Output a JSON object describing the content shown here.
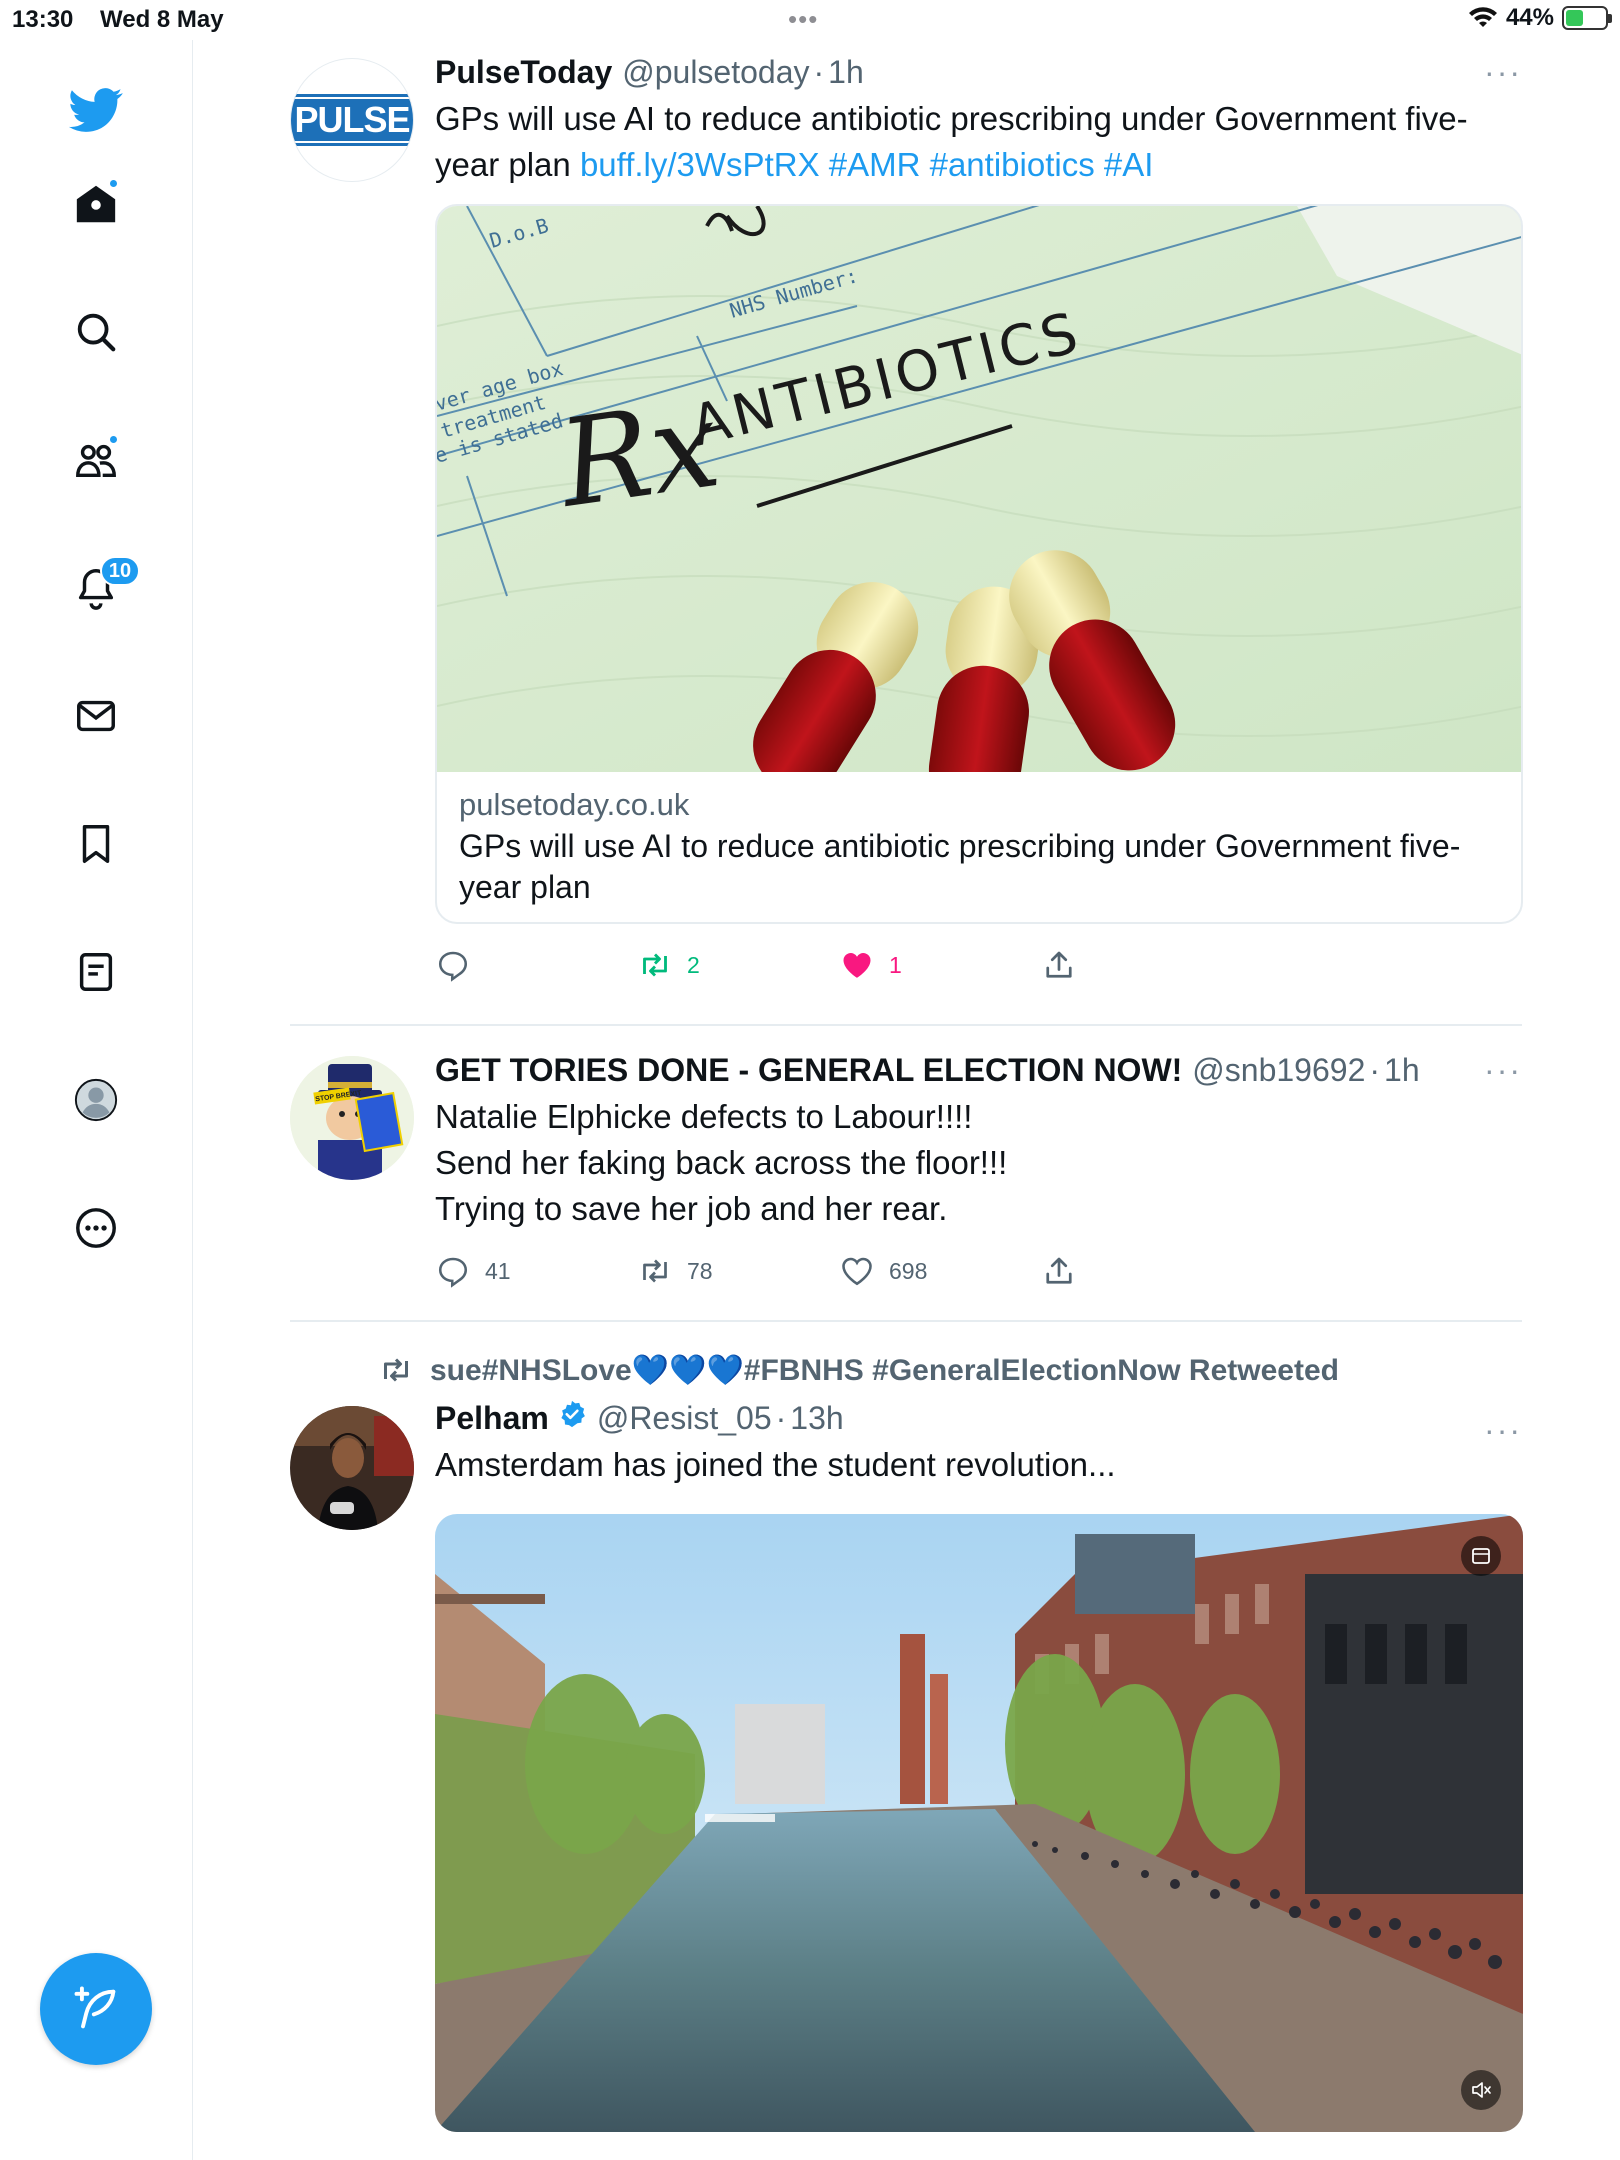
{
  "status_bar": {
    "time": "13:30",
    "date": "Wed 8 May",
    "battery": "44%",
    "battery_level": 0.44
  },
  "sidebar": {
    "items": [
      {
        "name": "twitter-logo"
      },
      {
        "name": "home",
        "has_dot": true
      },
      {
        "name": "explore"
      },
      {
        "name": "communities",
        "has_dot": true
      },
      {
        "name": "notifications",
        "badge": "10"
      },
      {
        "name": "messages"
      },
      {
        "name": "bookmarks"
      },
      {
        "name": "lists"
      },
      {
        "name": "profile"
      },
      {
        "name": "more"
      }
    ],
    "compose": "compose-tweet"
  },
  "tweets": [
    {
      "name": "PulseToday",
      "handle": "@pulsetoday",
      "time": "1h",
      "avatar_text": "PULSE",
      "text": "GPs will use AI to reduce antibiotic prescribing under Government five-year plan",
      "link": "buff.ly/3WsPtRX",
      "hashtags": "#AMR #antibiotics #AI",
      "card": {
        "domain": "pulsetoday.co.uk",
        "title": "GPs will use AI to reduce antibiotic prescribing under Government five-year plan",
        "image": {
          "dob": "D.o.B",
          "nhs": "NHS Number:",
          "box1": "ver age box",
          "box2": "treatment",
          "box3": "e is stated",
          "rx": "Rx",
          "word": "ANTIBIOTICS"
        }
      },
      "actions": {
        "reply": "",
        "retweet": "2",
        "like": "1"
      }
    },
    {
      "name": "GET TORIES DONE - GENERAL ELECTION NOW!",
      "handle": "@snb19692",
      "time": "1h",
      "avatar_text": "STOP BREXIT",
      "lines": [
        "Natalie Elphicke defects to Labour!!!!",
        "Send her faking back across the floor!!!",
        "Trying to save her job and her rear."
      ],
      "actions": {
        "reply": "41",
        "retweet": "78",
        "like": "698"
      }
    },
    {
      "retweeted_by": "sue#NHSLove💙💙💙#FBNHS #GeneralElectionNow Retweeted",
      "name": "Pelham",
      "handle": "@Resist_05",
      "time": "13h",
      "text": "Amsterdam has joined the student revolution..."
    }
  ],
  "colors": {
    "accent": "#1d9bf0",
    "retweet": "#00ba7c",
    "like": "#f91880"
  }
}
